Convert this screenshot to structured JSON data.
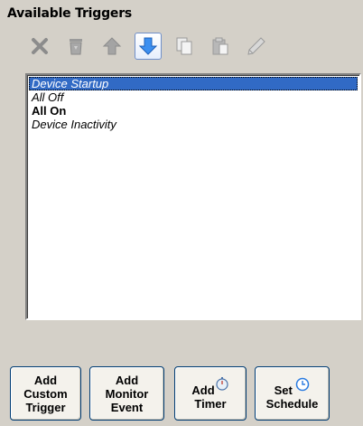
{
  "panel": {
    "title": "Available Triggers"
  },
  "toolbar": {
    "buttons": [
      {
        "icon": "delete-x-icon",
        "enabled": false
      },
      {
        "icon": "recycle-bin-icon",
        "enabled": false
      },
      {
        "icon": "move-up-arrow-icon",
        "enabled": false
      },
      {
        "icon": "move-down-arrow-icon",
        "enabled": true
      },
      {
        "icon": "copy-icon",
        "enabled": false
      },
      {
        "icon": "paste-icon",
        "enabled": false
      },
      {
        "icon": "edit-pencil-icon",
        "enabled": false
      }
    ]
  },
  "triggers": {
    "items": [
      {
        "label": "Device Startup",
        "style": "italic",
        "selected": true
      },
      {
        "label": "All Off",
        "style": "italic",
        "selected": false
      },
      {
        "label": "All On",
        "style": "bold",
        "selected": false
      },
      {
        "label": "Device Inactivity",
        "style": "italic",
        "selected": false
      }
    ]
  },
  "buttons": {
    "add_custom_trigger": "Add\nCustom\nTrigger",
    "add_monitor_event": "Add\nMonitor\nEvent",
    "add_timer_line1": "Add",
    "add_timer_line2": "Timer",
    "set_schedule_line1": "Set",
    "set_schedule_line2": "Schedule"
  },
  "colors": {
    "background": "#d4d0c8",
    "selection": "#316ac5",
    "button_border": "#003c74"
  }
}
